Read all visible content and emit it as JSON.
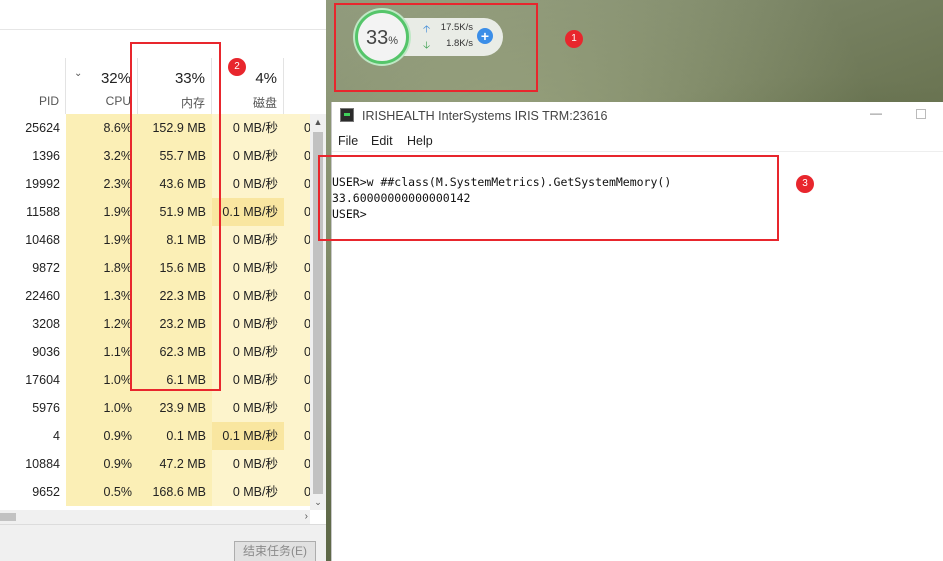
{
  "task_manager": {
    "columns": [
      {
        "key": "pid",
        "label": "PID",
        "percent": ""
      },
      {
        "key": "cpu",
        "label": "CPU",
        "percent": "32%"
      },
      {
        "key": "mem",
        "label": "内存",
        "percent": "33%"
      },
      {
        "key": "disk",
        "label": "磁盘",
        "percent": "4%"
      }
    ],
    "rows": [
      {
        "pid": "25624",
        "cpu": "8.6%",
        "mem": "152.9 MB",
        "disk": "0 MB/秒",
        "net": "0"
      },
      {
        "pid": "1396",
        "cpu": "3.2%",
        "mem": "55.7 MB",
        "disk": "0 MB/秒",
        "net": "0"
      },
      {
        "pid": "19992",
        "cpu": "2.3%",
        "mem": "43.6 MB",
        "disk": "0 MB/秒",
        "net": "0"
      },
      {
        "pid": "11588",
        "cpu": "1.9%",
        "mem": "51.9 MB",
        "disk": "0.1 MB/秒",
        "net": "0"
      },
      {
        "pid": "10468",
        "cpu": "1.9%",
        "mem": "8.1 MB",
        "disk": "0 MB/秒",
        "net": "0"
      },
      {
        "pid": "9872",
        "cpu": "1.8%",
        "mem": "15.6 MB",
        "disk": "0 MB/秒",
        "net": "0"
      },
      {
        "pid": "22460",
        "cpu": "1.3%",
        "mem": "22.3 MB",
        "disk": "0 MB/秒",
        "net": "0"
      },
      {
        "pid": "3208",
        "cpu": "1.2%",
        "mem": "23.2 MB",
        "disk": "0 MB/秒",
        "net": "0"
      },
      {
        "pid": "9036",
        "cpu": "1.1%",
        "mem": "62.3 MB",
        "disk": "0 MB/秒",
        "net": "0"
      },
      {
        "pid": "17604",
        "cpu": "1.0%",
        "mem": "6.1 MB",
        "disk": "0 MB/秒",
        "net": "0"
      },
      {
        "pid": "5976",
        "cpu": "1.0%",
        "mem": "23.9 MB",
        "disk": "0 MB/秒",
        "net": "0"
      },
      {
        "pid": "4",
        "cpu": "0.9%",
        "mem": "0.1 MB",
        "disk": "0.1 MB/秒",
        "net": "0"
      },
      {
        "pid": "10884",
        "cpu": "0.9%",
        "mem": "47.2 MB",
        "disk": "0 MB/秒",
        "net": "0"
      },
      {
        "pid": "9652",
        "cpu": "0.5%",
        "mem": "168.6 MB",
        "disk": "0 MB/秒",
        "net": "0"
      }
    ],
    "end_task_label": "结束任务(E)"
  },
  "widget": {
    "memory_percent": "33",
    "percent_sign": "%",
    "upload_speed": "17.5K/s",
    "download_speed": "1.8K/s",
    "ring_color": "#55c56a"
  },
  "terminal": {
    "title": "IRISHEALTH InterSystems IRIS TRM:23616",
    "menu": [
      "File",
      "Edit",
      "Help"
    ],
    "lines": [
      "USER>w ##class(M.SystemMetrics).GetSystemMemory()",
      "33.60000000000000142",
      "USER>"
    ]
  },
  "annotations": {
    "badges": [
      "1",
      "2",
      "3"
    ],
    "color": "#e8262d"
  }
}
